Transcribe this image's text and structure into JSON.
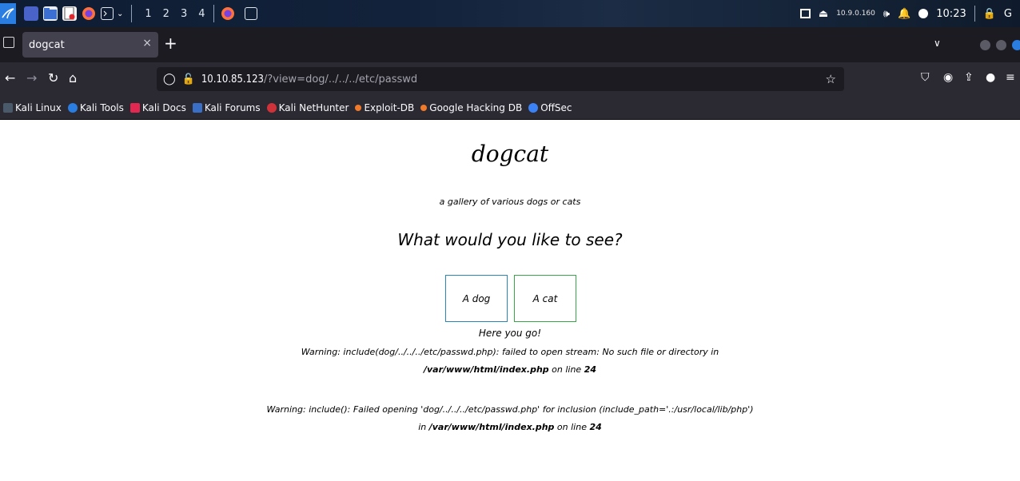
{
  "panel": {
    "workspaces": [
      "1",
      "2",
      "3",
      "4"
    ],
    "ip": "10.9.0.160",
    "clock": "10:23",
    "trailing": "G"
  },
  "browser": {
    "tab_title": "dogcat",
    "tab_close": "×",
    "new_tab": "+",
    "url_host": "10.10.85.123",
    "url_path": "/?view=dog/../../../etc/passwd",
    "bookmarks": [
      "Kali Linux",
      "Kali Tools",
      "Kali Docs",
      "Kali Forums",
      "Kali NetHunter",
      "Exploit-DB",
      "Google Hacking DB",
      "OffSec"
    ]
  },
  "page": {
    "title": "dogcat",
    "subtitle": "a gallery of various dogs or cats",
    "question": "What would you like to see?",
    "dog_button": "A dog",
    "cat_button": "A cat",
    "here": "Here you go!",
    "warning1_pre": "Warning: include(dog/../../../etc/passwd.php): failed to open stream: No such file or directory in ",
    "warning1_file": "/var/www/html/index.php",
    "warning1_mid": " on line ",
    "warning1_line": "24",
    "warning2_pre": "Warning: include(): Failed opening 'dog/../../../etc/passwd.php' for inclusion (include_path='.:/usr/local/lib/php') in ",
    "warning2_file": "/var/www/html/index.php",
    "warning2_mid": " on line ",
    "warning2_line": "24"
  }
}
